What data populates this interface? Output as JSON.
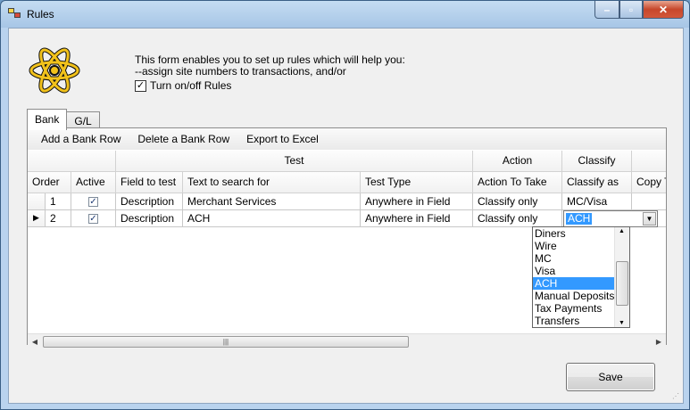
{
  "window": {
    "title": "Rules"
  },
  "caption": {
    "minimize": "–",
    "maximize": "▫",
    "close": "✕"
  },
  "intro": {
    "line1": "This form enables you to set up rules which will help you:",
    "line2": "--assign site numbers to transactions, and/or",
    "toggle_label": "Turn on/off Rules",
    "toggle_checked": true
  },
  "tabs": [
    "Bank",
    "G/L"
  ],
  "toolbar": {
    "add": "Add a Bank Row",
    "delete": "Delete a Bank Row",
    "export": "Export to Excel"
  },
  "grid": {
    "groups": [
      "Test",
      "Action",
      "Classify"
    ],
    "columns": [
      "Order",
      "Active",
      "Field to test",
      "Text to search for",
      "Test Type",
      "Action To Take",
      "Classify as",
      "Copy T"
    ],
    "rows": [
      {
        "order": "1",
        "active": true,
        "field": "Description",
        "text": "Merchant Services",
        "type": "Anywhere in Field",
        "action": "Classify only",
        "classify": "MC/Visa"
      },
      {
        "order": "2",
        "active": true,
        "field": "Description",
        "text": "ACH",
        "type": "Anywhere in Field",
        "action": "Classify only",
        "classify": "ACH"
      }
    ]
  },
  "dropdown": {
    "options": [
      "Diners",
      "Wire",
      "MC",
      "Visa",
      "ACH",
      "Manual Deposits",
      "Tax Payments",
      "Transfers"
    ],
    "selected": "ACH"
  },
  "save_label": "Save"
}
